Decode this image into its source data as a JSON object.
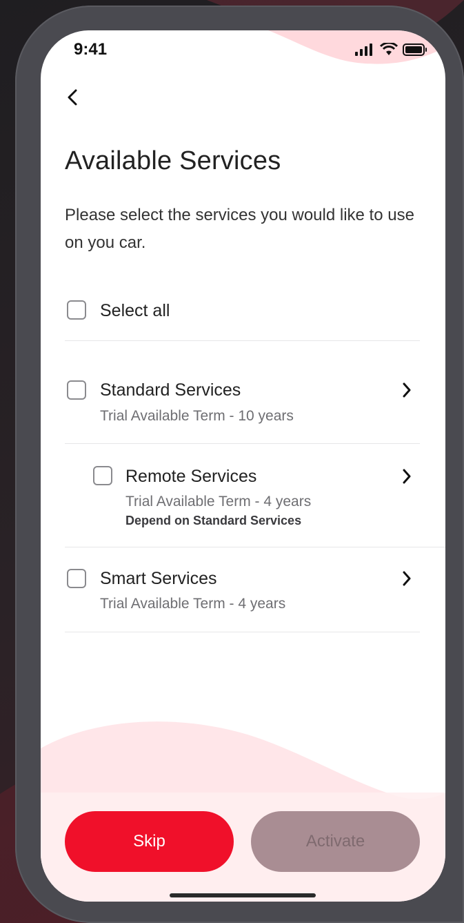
{
  "status_bar": {
    "time": "9:41"
  },
  "nav": {
    "back_icon": "chevron-left-icon"
  },
  "header": {
    "title": "Available Services",
    "subtitle": "Please select the services you would like to use on you car."
  },
  "select_all": {
    "label": "Select all",
    "checked": false
  },
  "services": [
    {
      "label": "Standard Services",
      "term": "Trial Available Term - 10 years",
      "dependency": "",
      "checked": false
    },
    {
      "label": "Remote Services",
      "term": "Trial Available Term - 4 years",
      "dependency": "Depend on Standard Services",
      "checked": false
    },
    {
      "label": "Smart Services",
      "term": "Trial Available Term - 4 years",
      "dependency": "",
      "checked": false
    }
  ],
  "footer": {
    "skip_label": "Skip",
    "activate_label": "Activate",
    "activate_enabled": false
  },
  "colors": {
    "accent": "#f0102a",
    "disabled_button": "#a98d93",
    "wave_tint": "#ffe3e6"
  }
}
